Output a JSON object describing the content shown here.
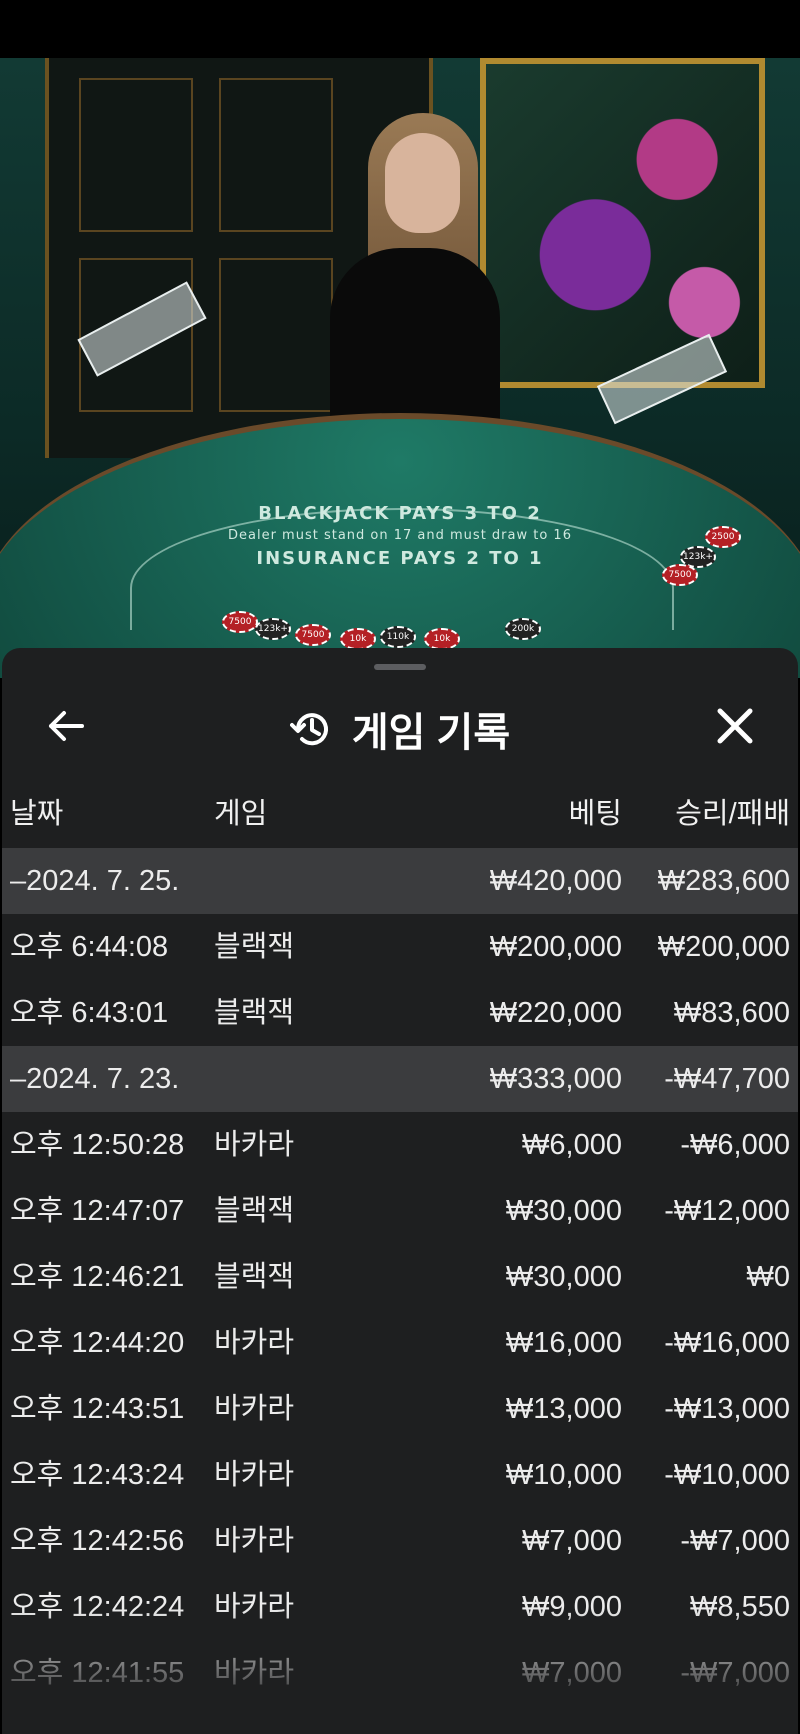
{
  "panel": {
    "title": "게임 기록",
    "icons": {
      "back": "arrow-left-icon",
      "history": "history-clock-icon",
      "close": "close-icon"
    }
  },
  "table_background": {
    "line1": "BLACKJACK PAYS 3 TO 2",
    "line2": "Dealer must stand on 17 and must draw to 16",
    "line3": "INSURANCE PAYS 2 TO 1",
    "chips": [
      "7500",
      "123k+",
      "7500",
      "10k",
      "110k",
      "10k",
      "200k",
      "2500",
      "123k+",
      "7500"
    ]
  },
  "columns": {
    "date": "날짜",
    "game": "게임",
    "bet": "베팅",
    "winloss": "승리/패배"
  },
  "rows": [
    {
      "type": "group",
      "time": "–2024. 7. 25.",
      "game": "",
      "bet": "₩420,000",
      "winloss": "₩283,600"
    },
    {
      "type": "item",
      "time": "오후 6:44:08",
      "game": "블랙잭",
      "bet": "₩200,000",
      "winloss": "₩200,000"
    },
    {
      "type": "item",
      "time": "오후 6:43:01",
      "game": "블랙잭",
      "bet": "₩220,000",
      "winloss": "₩83,600"
    },
    {
      "type": "group",
      "time": "–2024. 7. 23.",
      "game": "",
      "bet": "₩333,000",
      "winloss": "-₩47,700"
    },
    {
      "type": "item",
      "time": "오후 12:50:28",
      "game": "바카라",
      "bet": "₩6,000",
      "winloss": "-₩6,000"
    },
    {
      "type": "item",
      "time": "오후 12:47:07",
      "game": "블랙잭",
      "bet": "₩30,000",
      "winloss": "-₩12,000"
    },
    {
      "type": "item",
      "time": "오후 12:46:21",
      "game": "블랙잭",
      "bet": "₩30,000",
      "winloss": "₩0"
    },
    {
      "type": "item",
      "time": "오후 12:44:20",
      "game": "바카라",
      "bet": "₩16,000",
      "winloss": "-₩16,000"
    },
    {
      "type": "item",
      "time": "오후 12:43:51",
      "game": "바카라",
      "bet": "₩13,000",
      "winloss": "-₩13,000"
    },
    {
      "type": "item",
      "time": "오후 12:43:24",
      "game": "바카라",
      "bet": "₩10,000",
      "winloss": "-₩10,000"
    },
    {
      "type": "item",
      "time": "오후 12:42:56",
      "game": "바카라",
      "bet": "₩7,000",
      "winloss": "-₩7,000"
    },
    {
      "type": "item",
      "time": "오후 12:42:24",
      "game": "바카라",
      "bet": "₩9,000",
      "winloss": "₩8,550"
    },
    {
      "type": "item",
      "time": "오후 12:41:55",
      "game": "바카라",
      "bet": "₩7,000",
      "winloss": "-₩7,000"
    }
  ]
}
